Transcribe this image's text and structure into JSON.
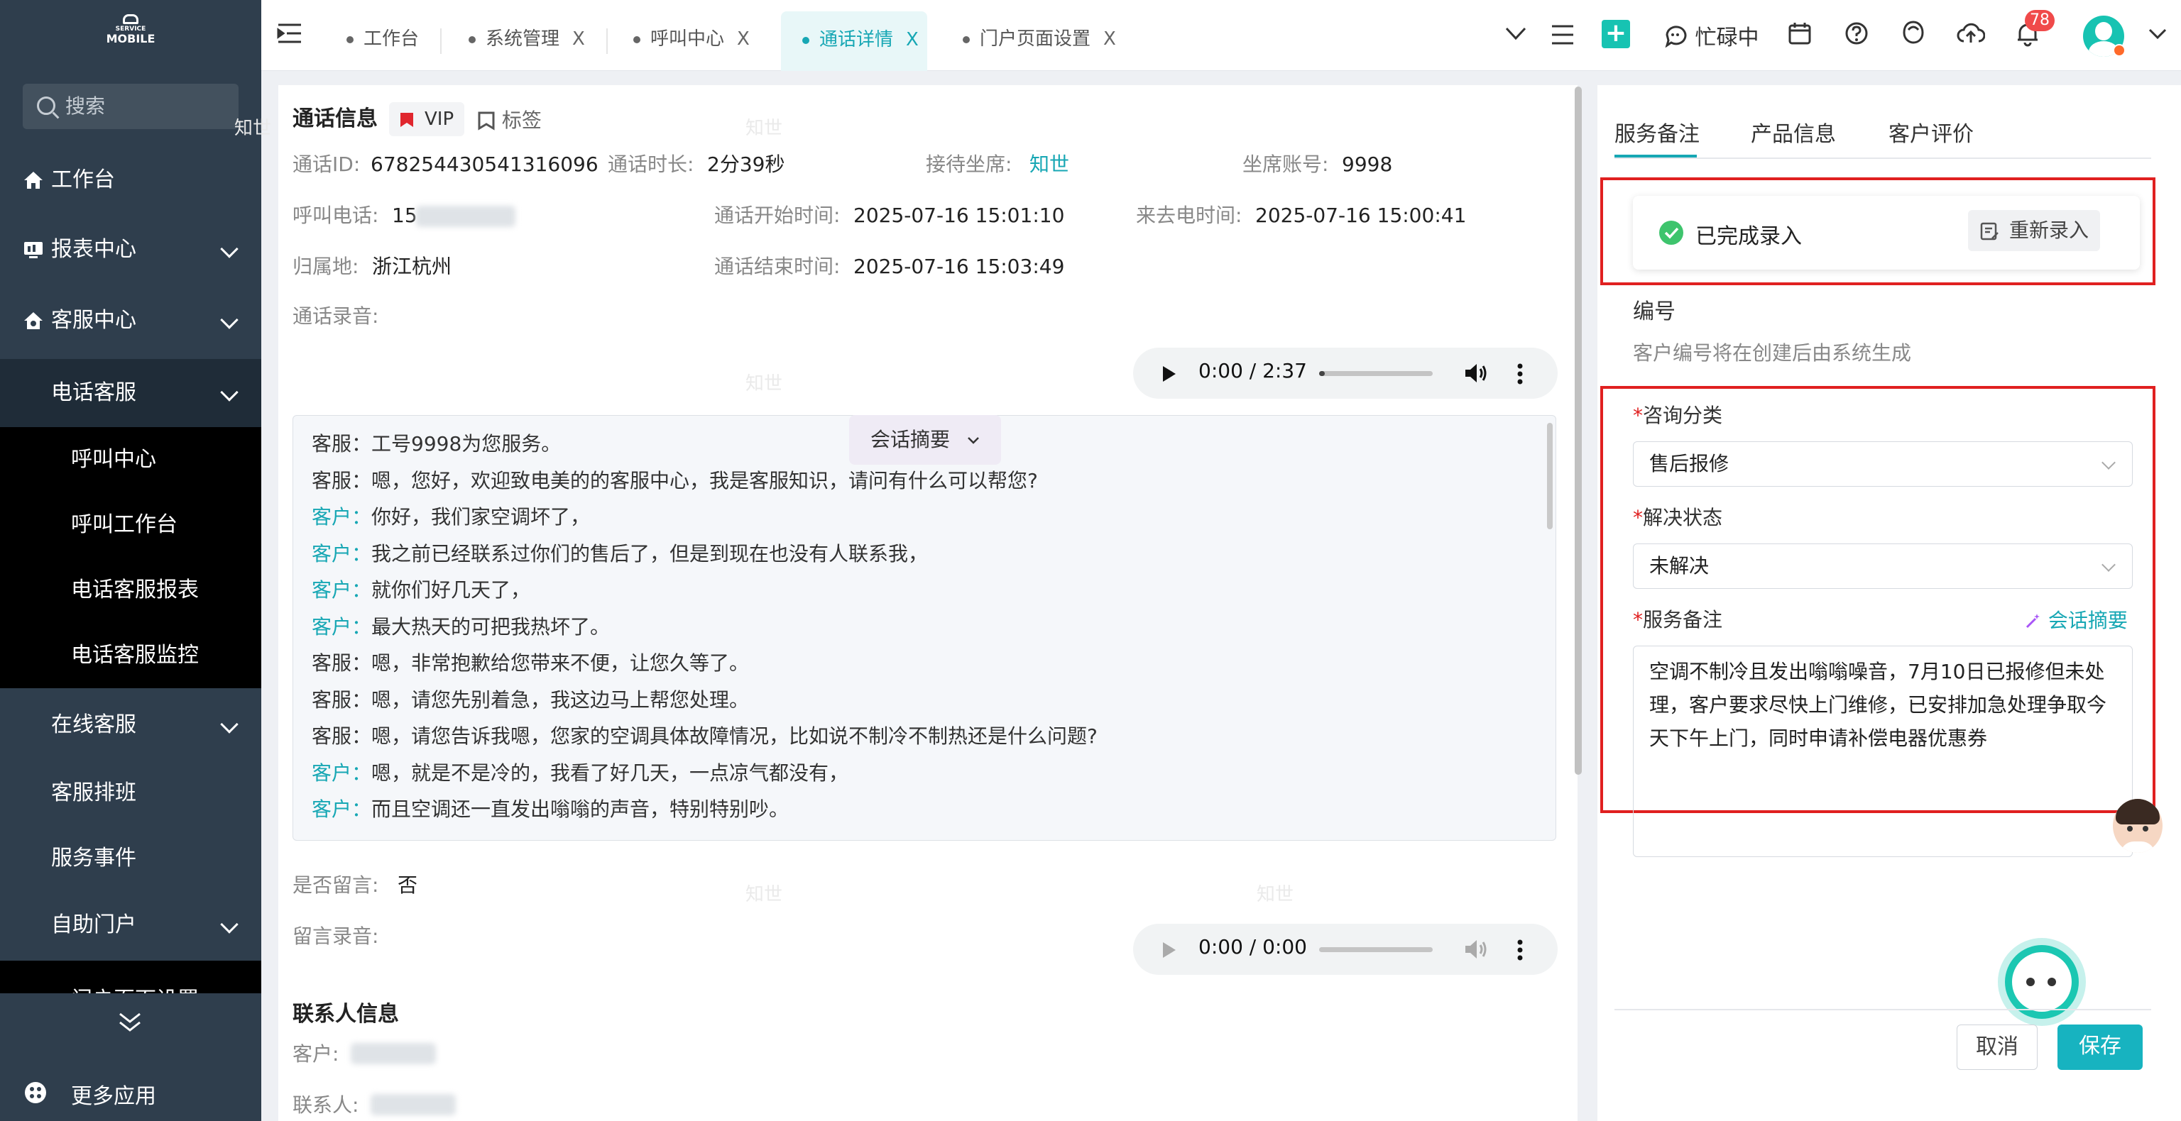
{
  "sidebar": {
    "logo_line1": "SERVICE",
    "logo_line2": "MOBILE",
    "search_placeholder": "搜索",
    "items": [
      {
        "label": "工作台"
      },
      {
        "label": "报表中心"
      },
      {
        "label": "客服中心"
      },
      {
        "label": "电话客服"
      },
      {
        "label": "呼叫中心"
      },
      {
        "label": "呼叫工作台"
      },
      {
        "label": "电话客服报表"
      },
      {
        "label": "电话客服监控"
      },
      {
        "label": "在线客服"
      },
      {
        "label": "客服排班"
      },
      {
        "label": "服务事件"
      },
      {
        "label": "自助门户"
      },
      {
        "label": "门户页面设置"
      }
    ],
    "more_apps": "更多应用"
  },
  "tabs": [
    {
      "label": "工作台",
      "closable": false
    },
    {
      "label": "系统管理",
      "closable": true
    },
    {
      "label": "呼叫中心",
      "closable": true
    },
    {
      "label": "通话详情",
      "closable": true,
      "active": true
    },
    {
      "label": "门户页面设置",
      "closable": true
    }
  ],
  "toolbar": {
    "status": "忙碌中",
    "notif_count": "78",
    "close_glyph": "X"
  },
  "call_info": {
    "section_title": "通话信息",
    "vip": "VIP",
    "tag": "标签",
    "call_id_label": "通话ID:",
    "call_id": "678254430541316096",
    "duration_label": "通话时长:",
    "duration": "2分39秒",
    "agent_label": "接待坐席:",
    "agent": "知世",
    "seat_label": "坐席账号:",
    "seat": "9998",
    "phone_label": "呼叫电话:",
    "phone_prefix": "15",
    "start_label": "通话开始时间:",
    "start": "2025-07-16 15:01:10",
    "incoming_label": "来去电时间:",
    "incoming": "2025-07-16 15:00:41",
    "location_label": "归属地:",
    "location": "浙江杭州",
    "end_label": "通话结束时间:",
    "end": "2025-07-16 15:03:49",
    "recording_label": "通话录音:",
    "audio_time": "0:00 / 2:37",
    "audio_progress": 0.05
  },
  "transcript": {
    "summary_button": "会话摘要",
    "lines": [
      {
        "speaker": "客服：",
        "text": "工号9998为您服务。",
        "role": "agent"
      },
      {
        "speaker": "客服：",
        "text": "嗯，您好，欢迎致电美的的客服中心，我是客服知识，请问有什么可以帮您?",
        "role": "agent"
      },
      {
        "speaker": "客户：",
        "text": "你好，我们家空调坏了，",
        "role": "customer"
      },
      {
        "speaker": "客户：",
        "text": "我之前已经联系过你们的售后了，但是到现在也没有人联系我，",
        "role": "customer"
      },
      {
        "speaker": "客户：",
        "text": "就你们好几天了，",
        "role": "customer"
      },
      {
        "speaker": "客户：",
        "text": "最大热天的可把我热坏了。",
        "role": "customer"
      },
      {
        "speaker": "客服：",
        "text": "嗯，非常抱歉给您带来不便，让您久等了。",
        "role": "agent"
      },
      {
        "speaker": "客服：",
        "text": "嗯，请您先别着急，我这边马上帮您处理。",
        "role": "agent"
      },
      {
        "speaker": "客服：",
        "text": "嗯，请您告诉我嗯，您家的空调具体故障情况，比如说不制冷不制热还是什么问题?",
        "role": "agent"
      },
      {
        "speaker": "客户：",
        "text": "嗯，就是不是冷的，我看了好几天，一点凉气都没有，",
        "role": "customer"
      },
      {
        "speaker": "客户：",
        "text": "而且空调还一直发出嗡嗡的声音，特别特别吵。",
        "role": "customer"
      }
    ]
  },
  "voicemail": {
    "left_msg_label": "是否留言:",
    "left_msg": "否",
    "recording_label": "留言录音:",
    "audio_time": "0:00 / 0:00"
  },
  "contact": {
    "section_title": "联系人信息",
    "customer_label": "客户:",
    "contact_label": "联系人:"
  },
  "watermark": "知世",
  "right": {
    "tabs": [
      "服务备注",
      "产品信息",
      "客户评价"
    ],
    "done_status": "已完成录入",
    "reenter_button": "重新录入",
    "number_label": "编号",
    "number_hint": "客户编号将在创建后由系统生成",
    "required_mark": "*",
    "category_label": "咨询分类",
    "category_value": "售后报修",
    "resolve_label": "解决状态",
    "resolve_value": "未解决",
    "note_label": "服务备注",
    "note_summary_link": "会话摘要",
    "note_value": "空调不制冷且发出嗡嗡噪音，7月10日已报修但未处理，客户要求尽快上门维修，已安排加急处理争取今天下午上门，同时申请补偿电器优惠券",
    "cancel": "取消",
    "save": "保存"
  },
  "colors": {
    "accent": "#17a7b4",
    "sidebar_bg": "#2f3e4d",
    "highlight_red": "#e02020",
    "success_green": "#3ec46d"
  }
}
